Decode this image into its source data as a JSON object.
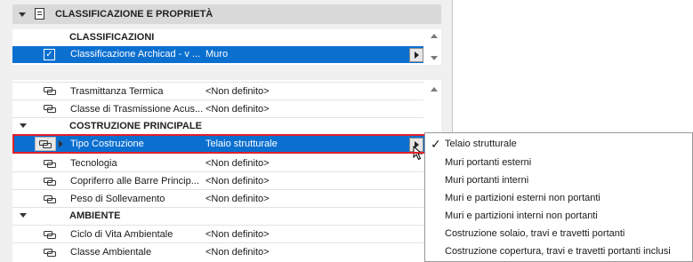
{
  "section": {
    "title": "CLASSIFICAZIONE E PROPRIETÀ"
  },
  "classifications": {
    "title": "CLASSIFICAZIONI",
    "row": {
      "name": "Classificazione Archicad - v ...",
      "value": "Muro",
      "checked": true
    }
  },
  "properties": {
    "top_rows": [
      {
        "name": "Trasmittanza Termica",
        "value": "<Non definito>"
      },
      {
        "name": "Classe di Trasmissione Acus...",
        "value": "<Non definito>"
      }
    ],
    "groups": [
      {
        "title": "COSTRUZIONE PRINCIPALE",
        "rows": [
          {
            "name": "Tipo Costruzione",
            "value": "Telaio strutturale",
            "selected": true
          },
          {
            "name": "Tecnologia",
            "value": "<Non definito>"
          },
          {
            "name": "Copriferro alle Barre Princip...",
            "value": "<Non definito>"
          },
          {
            "name": "Peso di Sollevamento",
            "value": "<Non definito>"
          }
        ]
      },
      {
        "title": "AMBIENTE",
        "rows": [
          {
            "name": "Ciclo di Vita Ambientale",
            "value": "<Non definito>"
          },
          {
            "name": "Classe Ambientale",
            "value": "<Non definito>"
          }
        ]
      }
    ]
  },
  "dropdown": {
    "selected": "Telaio strutturale",
    "options": [
      "Telaio strutturale",
      "Muri portanti esterni",
      "Muri portanti interni",
      "Muri e partizioni esterni non portanti",
      "Muri e partizioni interni non portanti",
      "Costruzione solaio, travi e travetti portanti",
      "Costruzione copertura, travi e travetti portanti inclusi"
    ]
  },
  "colors": {
    "selection": "#0b6fd0",
    "highlight_border": "#e0202a",
    "panel_bg": "#f0f0f0"
  },
  "icons": {
    "section_toggle": "triangle-down-icon",
    "section_doc": "document-icon",
    "row_link": "link-icon",
    "selected_check": "checkmark-icon"
  }
}
